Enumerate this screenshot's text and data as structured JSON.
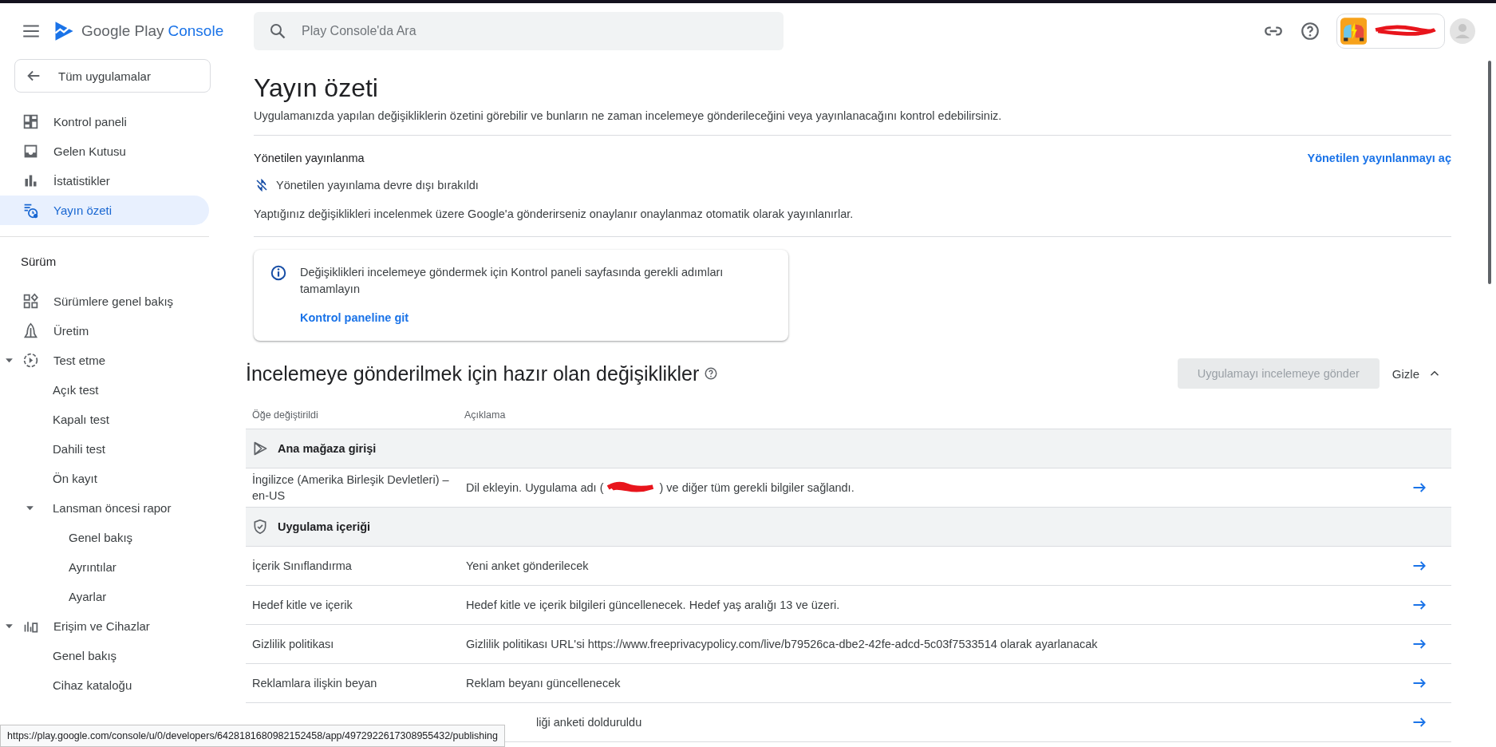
{
  "header": {
    "product": "Google Play",
    "product_suffix": "Console",
    "search": {
      "placeholder": "Play Console'da Ara"
    }
  },
  "sidebar": {
    "back_button": "Tüm uygulamalar",
    "items": [
      {
        "label": "Kontrol paneli",
        "selected": false
      },
      {
        "label": "Gelen Kutusu",
        "selected": false
      },
      {
        "label": "İstatistikler",
        "selected": false
      },
      {
        "label": "Yayın özeti",
        "selected": true
      }
    ],
    "section": {
      "title": "Sürüm",
      "items": [
        {
          "label": "Sürümlere genel bakış",
          "selected": false
        },
        {
          "label": "Üretim",
          "selected": false
        },
        {
          "label": "Test etme",
          "selected": false,
          "expanded": true,
          "children": [
            {
              "label": "Açık test",
              "selected": false
            },
            {
              "label": "Kapalı test",
              "selected": false
            },
            {
              "label": "Dahili test",
              "selected": false
            },
            {
              "label": "Ön kayıt",
              "selected": false
            },
            {
              "label": "Lansman öncesi rapor",
              "selected": false,
              "expanded": true,
              "children": [
                {
                  "label": "Genel bakış",
                  "selected": false
                },
                {
                  "label": "Ayrıntılar",
                  "selected": false
                },
                {
                  "label": "Ayarlar",
                  "selected": false
                }
              ]
            }
          ]
        },
        {
          "label": "Erişim ve Cihazlar",
          "selected": false,
          "expanded": true,
          "children": [
            {
              "label": "Genel bakış",
              "selected": false
            },
            {
              "label": "Cihaz kataloğu",
              "selected": false
            }
          ]
        }
      ]
    }
  },
  "page": {
    "title": "Yayın özeti",
    "subtitle": "Uygulamanızda yapılan değişikliklerin özetini görebilir ve bunların ne zaman incelemeye gönderileceğini veya yayınlanacağını kontrol edebilirsiniz."
  },
  "managed_publishing": {
    "title": "Yönetilen yayınlanma",
    "action": "Yönetilen yayınlanmayı aç",
    "on": false,
    "status": "Yönetilen yayınlama devre dışı bırakıldı",
    "note": "Yaptığınız değişiklikleri incelenmek üzere Google'a gönderirseniz onaylanır onaylanmaz otomatik olarak yayınlanırlar."
  },
  "notice": {
    "text": "Değişiklikleri incelemeye göndermek için Kontrol paneli sayfasında gerekli adımları tamamlayın",
    "link": "Kontrol paneline git"
  },
  "changes": {
    "title": "İncelemeye gönderilmek için hazır olan değişiklikler",
    "submit_button": {
      "label": "Uygulamayı incelemeye gönder",
      "disabled": true
    },
    "toggle": {
      "label": "Gizle",
      "expanded": true
    },
    "columns": [
      "Öğe değiştirildi",
      "Açıklama"
    ],
    "groups": [
      {
        "title": "Ana mağaza girişi",
        "rows": [
          {
            "item": "İngilizce (Amerika Birleşik Devletleri) – en-US",
            "description": [
              "Dil ekleyin. Uygulama adı (",
              ") ve diğer tüm gerekli bilgiler sağlandı."
            ]
          }
        ]
      },
      {
        "title": "Uygulama içeriği",
        "rows": [
          {
            "item": "İçerik Sınıflandırma",
            "description": [
              "Yeni anket gönderilecek"
            ]
          },
          {
            "item": "Hedef kitle ve içerik",
            "description": [
              "Hedef kitle ve içerik bilgileri güncellenecek. Hedef yaş aralığı 13 ve üzeri."
            ]
          },
          {
            "item": "Gizlilik politikası",
            "description": [
              "Gizlilik politikası URL'si https://www.freeprivacypolicy.com/live/b79526ca-dbe2-42fe-adcd-5c03f7533514 olarak ayarlanacak"
            ]
          },
          {
            "item": "Reklamlara ilişkin beyan",
            "description": [
              "Reklam beyanı güncellenecek"
            ]
          },
          {
            "description": [
              "liği anketi dolduruldu"
            ]
          }
        ]
      }
    ]
  },
  "status_bar": {
    "url": "https://play.google.com/console/u/0/developers/6428181680982152458/app/4972922617308955432/publishing"
  }
}
